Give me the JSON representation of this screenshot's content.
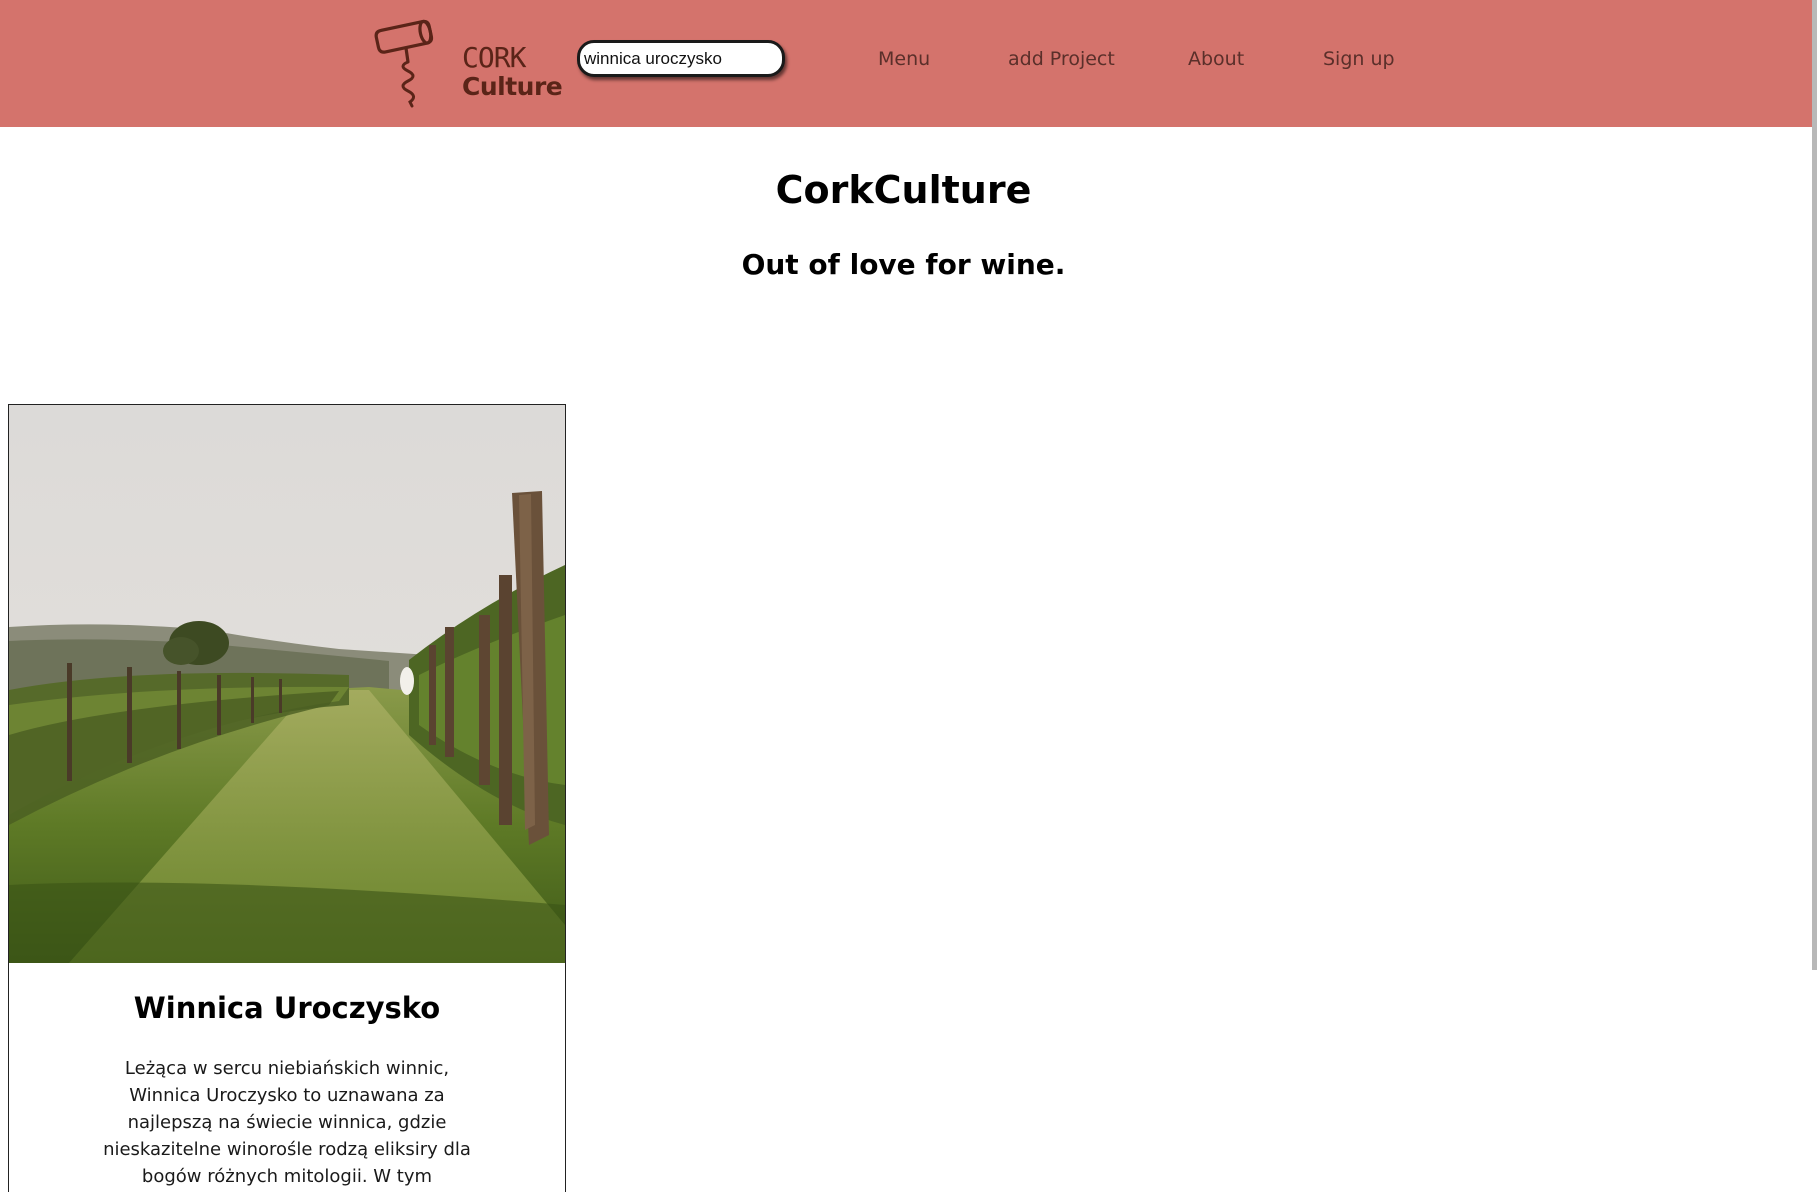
{
  "header": {
    "logo": {
      "line1": "CORK",
      "line2": "Culture",
      "icon": "corkscrew-icon"
    },
    "search": {
      "value": "winnica uroczysko",
      "placeholder": ""
    },
    "nav": [
      {
        "label": "Menu"
      },
      {
        "label": "add Project"
      },
      {
        "label": "About"
      },
      {
        "label": "Sign up"
      }
    ],
    "bg_color": "#d4736c",
    "text_color": "#5a2f2a"
  },
  "hero": {
    "title": "CorkCulture",
    "subtitle": "Out of love for wine."
  },
  "cards": [
    {
      "image": "vineyard-photo",
      "title": "Winnica Uroczysko",
      "text": "Leżąca w sercu niebiańskich winnic, Winnica Uroczysko to uznawana za najlepszą na świecie winnica, gdzie nieskazitelne winorośle rodzą eliksiry dla bogów różnych mitologii. W tym mitycznym miejscu, gdzie"
    }
  ]
}
